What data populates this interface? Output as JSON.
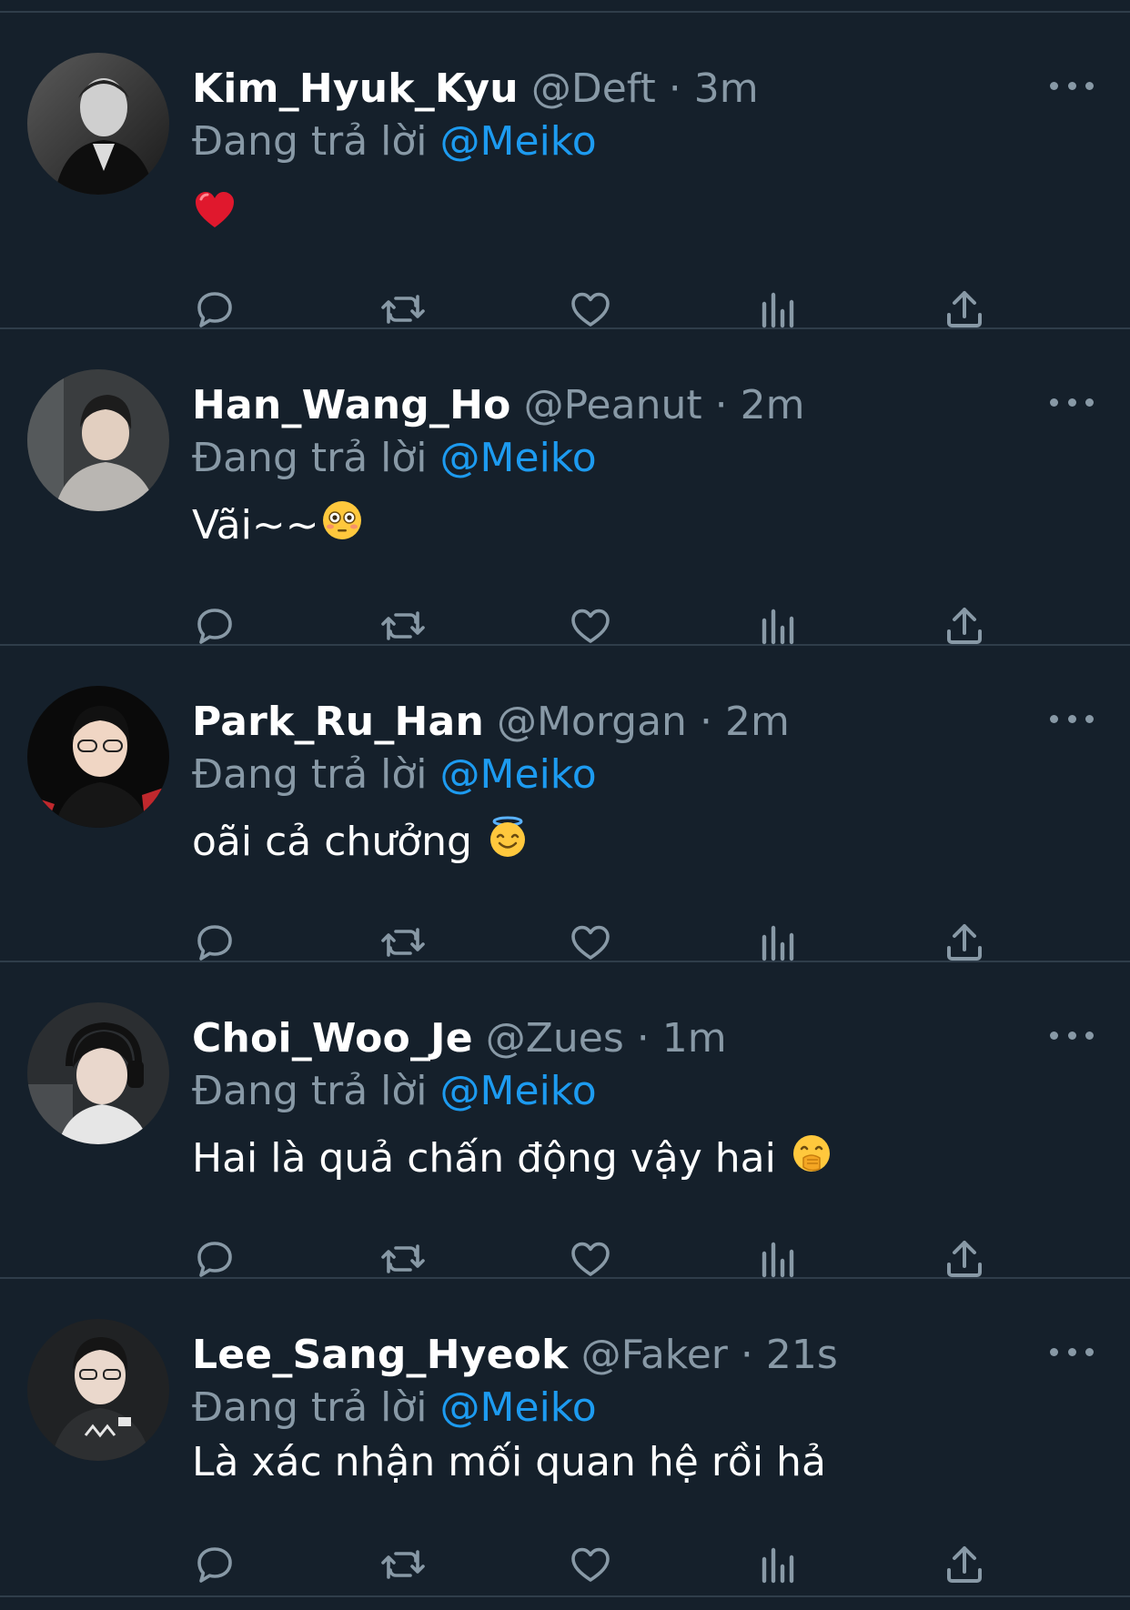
{
  "tweets": [
    {
      "name": "Kim_Hyuk_Kyu",
      "handle": "@Deft",
      "dot": "·",
      "time": "3m",
      "reply_prefix": "Đang trả lời",
      "reply_mention": "@Meiko",
      "text": "",
      "emoji": "red-heart-icon",
      "avatar_tone": "grayscale"
    },
    {
      "name": "Han_Wang_Ho",
      "handle": "@Peanut",
      "dot": "·",
      "time": "2m",
      "reply_prefix": "Đang trả lời",
      "reply_mention": "@Meiko",
      "text": "Vãi~~",
      "emoji": "flushed-face-icon",
      "avatar_tone": "light"
    },
    {
      "name": "Park_Ru_Han",
      "handle": "@Morgan",
      "dot": "·",
      "time": "2m",
      "reply_prefix": "Đang trả lời",
      "reply_mention": "@Meiko",
      "text": "oãi cả chưởng",
      "emoji": "smiling-face-with-halo-icon",
      "avatar_tone": "dark"
    },
    {
      "name": "Choi_Woo_Je",
      "handle": "@Zues",
      "dot": "·",
      "time": "1m",
      "reply_prefix": "Đang trả lời",
      "reply_mention": "@Meiko",
      "text": "Hai là quả chấn động vậy hai",
      "emoji": "face-with-hand-over-mouth-icon",
      "avatar_tone": "dim"
    },
    {
      "name": "Lee_Sang_Hyeok",
      "handle": "@Faker",
      "dot": "·",
      "time": "21s",
      "reply_prefix": "Đang trả lời",
      "reply_mention": "@Meiko",
      "text": "Là xác nhận mối quan hệ rồi hả",
      "emoji": "",
      "avatar_tone": "dark"
    }
  ],
  "colors": {
    "background": "#15202b",
    "divider": "#2f3d4a",
    "secondary_text": "#8899a6",
    "link": "#1d9bf0"
  },
  "action_icons": [
    "reply-icon",
    "retweet-icon",
    "like-icon",
    "views-icon",
    "share-icon"
  ]
}
